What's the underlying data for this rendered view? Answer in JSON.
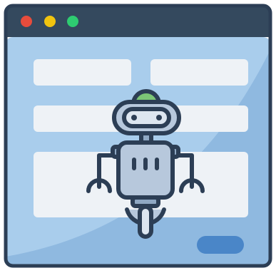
{
  "illustration": {
    "subject": "browser-window-with-form-and-robot",
    "icons": [
      "browser-window-icon",
      "robot-icon"
    ],
    "colors": {
      "outline": "#2c3e55",
      "title_bar": "#34495e",
      "window_body": "#a9cdec",
      "window_shade": "#8fb9e0",
      "form_field": "#eef2f6",
      "submit_button": "#4a86c8",
      "dot_red": "#e74c3c",
      "dot_yellow": "#f1c40f",
      "dot_green": "#2ecc71",
      "robot_body": "#b7c8dc",
      "robot_face": "#dde6f0",
      "robot_eye": "#2c3e55",
      "robot_antenna": "#7cc576"
    },
    "form_fields_count": 4,
    "window_controls": [
      "close",
      "minimize",
      "maximize"
    ]
  }
}
